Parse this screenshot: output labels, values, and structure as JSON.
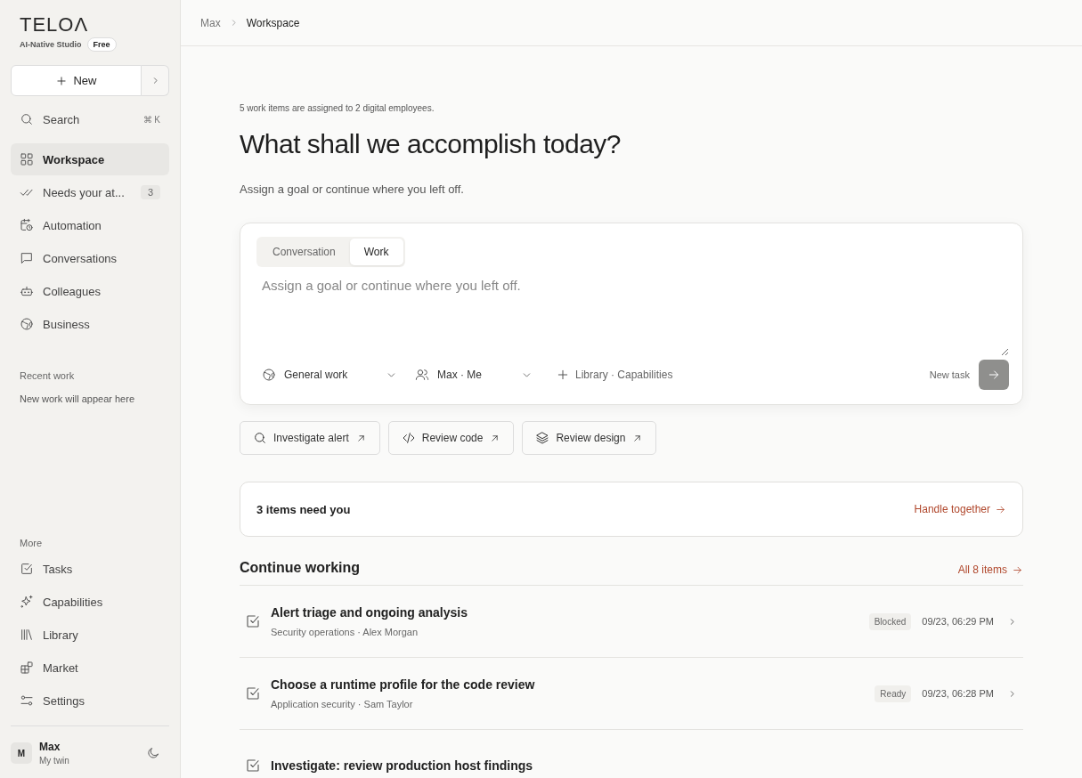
{
  "brand": {
    "logo": "TELOΛ",
    "subtitle": "AI-Native Studio",
    "plan": "Free"
  },
  "sidebar": {
    "new_button": "New",
    "search": {
      "label": "Search",
      "shortcut": "⌘ K"
    },
    "items": [
      {
        "label": "Workspace",
        "selected": true
      },
      {
        "label": "Needs your at...",
        "selected": false,
        "count": "3"
      },
      {
        "label": "Automation",
        "selected": false
      },
      {
        "label": "Conversations",
        "selected": false
      },
      {
        "label": "Colleagues",
        "selected": false
      },
      {
        "label": "Business",
        "selected": false
      }
    ],
    "recent_heading": "Recent work",
    "recent_empty": "New work will appear here",
    "more_heading": "More",
    "more_items": [
      {
        "label": "Tasks"
      },
      {
        "label": "Capabilities"
      },
      {
        "label": "Library"
      },
      {
        "label": "Market"
      },
      {
        "label": "Settings"
      }
    ],
    "user": {
      "initial": "M",
      "name": "Max",
      "role": "My twin"
    }
  },
  "breadcrumb": [
    "Max",
    "Workspace"
  ],
  "intro": "5 work items are assigned to 2 digital employees.",
  "heading": "What shall we accomplish today?",
  "subheading": "Assign a goal or continue where you left off.",
  "composer": {
    "tabs": [
      {
        "label": "Conversation",
        "selected": false
      },
      {
        "label": "Work",
        "selected": true
      }
    ],
    "placeholder": "Assign a goal or continue where you left off.",
    "work_type": "General work",
    "assignee": "Max · Me",
    "add": "Library · Capabilities",
    "hint": "New task"
  },
  "suggestions": [
    "Investigate alert",
    "Review code",
    "Review design"
  ],
  "attention": {
    "text": "3 items need you",
    "action": "Handle together"
  },
  "continue": {
    "title": "Continue working",
    "link": "All 8 items",
    "rows": [
      {
        "title": "Alert triage and ongoing analysis",
        "meta": "Security operations · Alex Morgan",
        "status": "Blocked",
        "time": "09/23, 06:29 PM"
      },
      {
        "title": "Choose a runtime profile for the code review",
        "meta": "Application security · Sam Taylor",
        "status": "Ready",
        "time": "09/23, 06:28 PM"
      },
      {
        "title": "Investigate: review production host findings"
      }
    ]
  }
}
